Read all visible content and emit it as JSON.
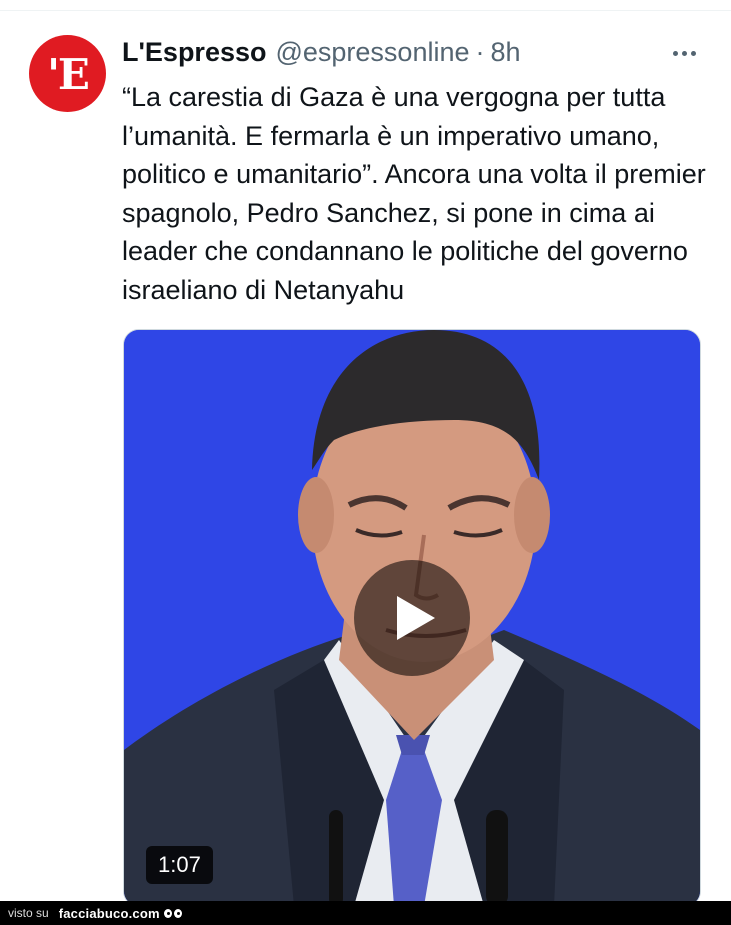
{
  "tweet": {
    "avatar_text": "'E",
    "display_name": "L'Espresso",
    "handle": "@espressonline",
    "separator": "·",
    "time": "8h",
    "more_icon": "more-horizontal-icon",
    "text": "“La carestia di Gaza è una vergogna per tutta l’umanità. E fermarla è un imperativo umano, politico e umanitario”. Ancora una volta il premier spagnolo, Pedro Sanchez, si pone in cima ai leader che condannano le politiche del governo israeliano di Netanyahu"
  },
  "video": {
    "duration": "1:07",
    "play_icon": "play-icon",
    "background_color": "#2f46e6"
  },
  "footer": {
    "visto_su": "visto su",
    "brand": "facciabuco.com",
    "brand_icon": "eyes-icon"
  },
  "colors": {
    "avatar_red": "#e01b22",
    "text_primary": "#0f1419",
    "text_secondary": "#536471"
  }
}
